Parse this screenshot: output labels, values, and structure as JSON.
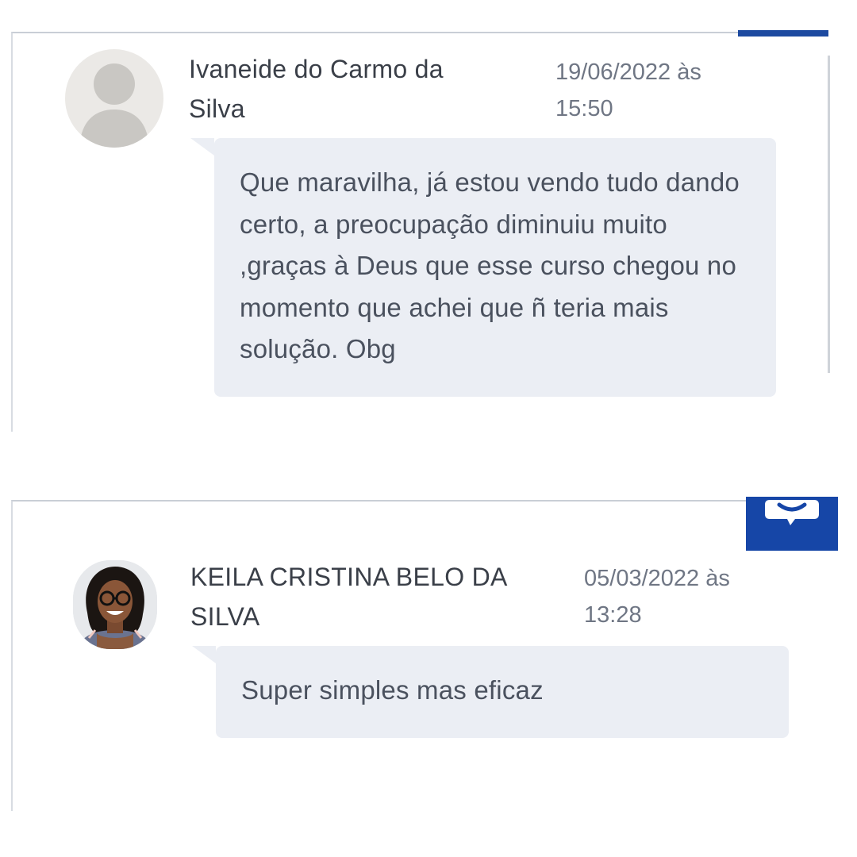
{
  "comments": [
    {
      "author_line1": "Ivaneide do Carmo da",
      "author_line2": "Silva",
      "date_line1": "19/06/2022 às",
      "date_line2": "15:50",
      "text": "Que maravilha, já estou vendo tudo dando certo, a preocupação diminuiu muito ,graças à Deus que esse curso chegou no momento que achei que ñ teria mais solução. Obg",
      "avatar": "default-user-icon"
    },
    {
      "author_line1": "KEILA CRISTINA BELO DA",
      "author_line2": "SILVA",
      "date_line1": "05/03/2022 às",
      "date_line2": "13:28",
      "text": "Super simples mas eficaz",
      "avatar": "profile-photo"
    }
  ],
  "colors": {
    "accent": "#1646a7",
    "bubble": "#ebeef4",
    "text": "#4a515e",
    "muted": "#6f7684"
  },
  "icons": {
    "chat_badge": "chat-bubble-icon"
  }
}
